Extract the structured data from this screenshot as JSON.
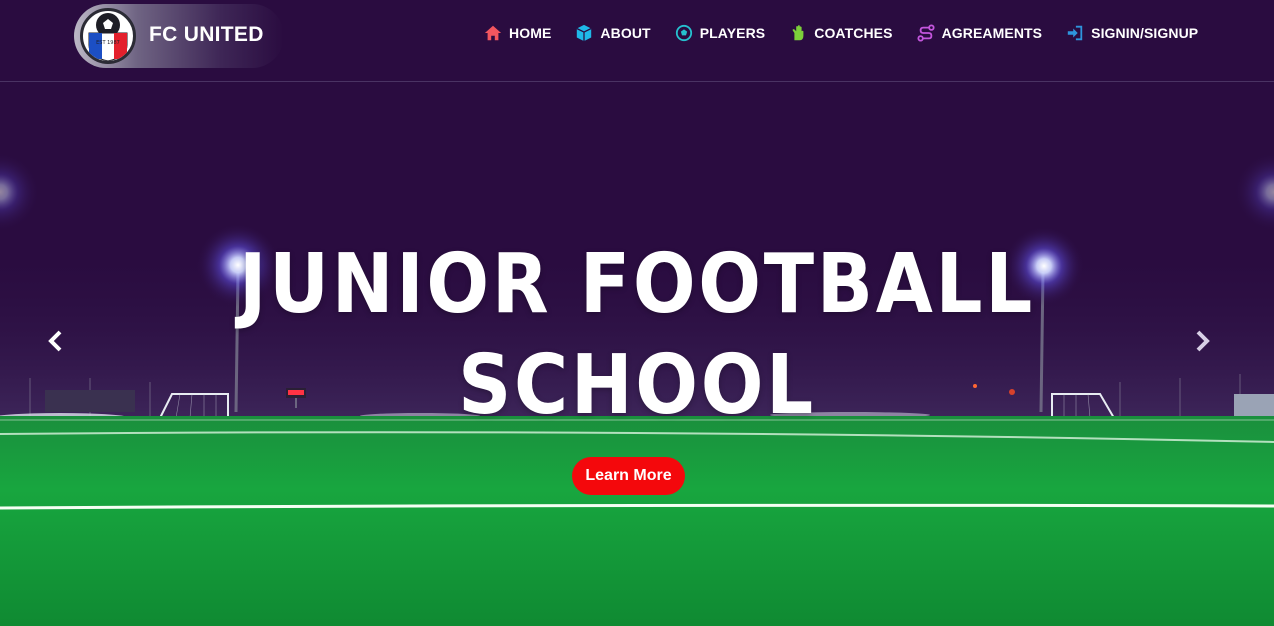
{
  "brand": {
    "name": "FC UNITED",
    "logo_text": "EST 1987"
  },
  "nav": {
    "items": [
      {
        "label": "HOME",
        "icon": "home-icon",
        "color": "#f2565f"
      },
      {
        "label": "ABOUT",
        "icon": "cube-icon",
        "color": "#1fb8e8"
      },
      {
        "label": "PLAYERS",
        "icon": "soccer-ball-icon",
        "color": "#26c1cf"
      },
      {
        "label": "COATCHES",
        "icon": "hand-icon",
        "color": "#7ccf3a"
      },
      {
        "label": "AGREAMENTS",
        "icon": "route-icon",
        "color": "#c456dd"
      },
      {
        "label": "SIGNIN/SIGNUP",
        "icon": "sign-in-icon",
        "color": "#2e95dd"
      }
    ]
  },
  "hero": {
    "title_line1": "JUNIOR FOOTBALL",
    "title_line2": "SCHOOL",
    "cta_label": "Learn More",
    "carousel_prev": "chevron-left-icon",
    "carousel_next": "chevron-right-icon"
  },
  "colors": {
    "header_bg": "#2a0c40",
    "cta_bg": "#f4080c",
    "pitch_green": "#16a038"
  }
}
